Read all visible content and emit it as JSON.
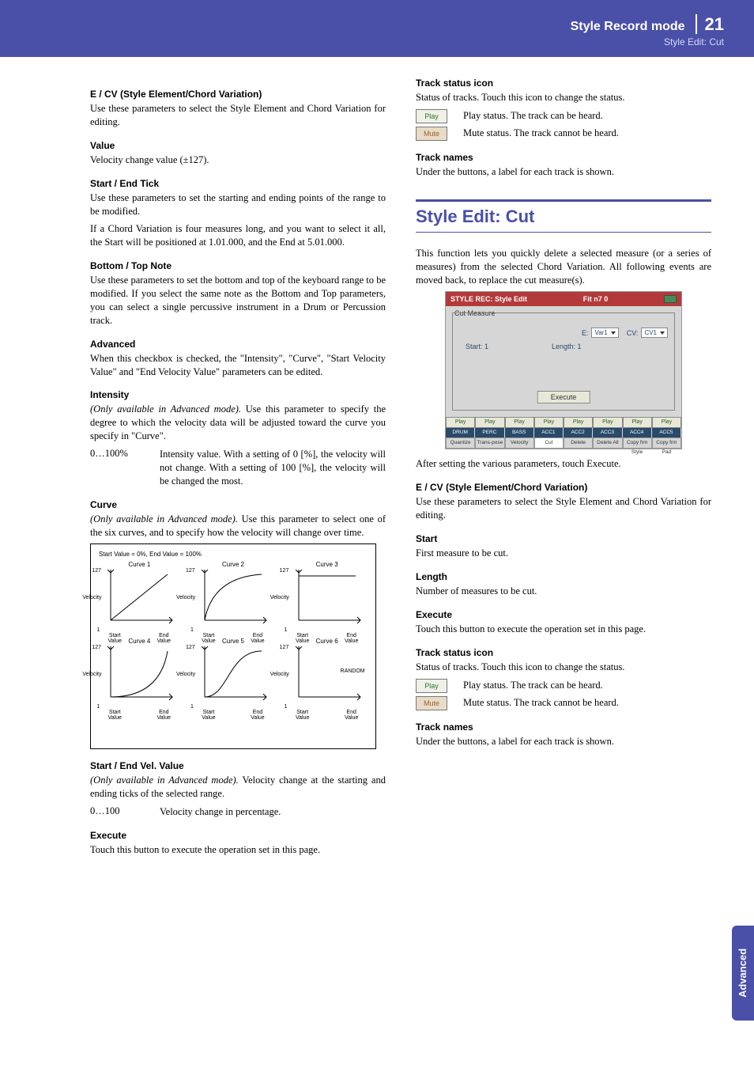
{
  "header": {
    "title": "Style Record mode",
    "page_number": "21",
    "subtitle": "Style Edit: Cut"
  },
  "side_tab": "Advanced",
  "left": {
    "h_ecv": "E / CV (Style Element/Chord Variation)",
    "p_ecv": "Use these parameters to select the Style Element and Chord Variation for editing.",
    "h_value": "Value",
    "p_value": "Velocity change value (±127).",
    "h_set": "Start / End Tick",
    "p_set1": "Use these parameters to set the starting and ending points of the range to be modified.",
    "p_set2": "If a Chord Variation is four measures long, and you want to select it all, the Start will be positioned at 1.01.000, and the End at 5.01.000.",
    "h_btn": "Bottom / Top Note",
    "p_btn": "Use these parameters to set the bottom and top of the keyboard range to be modified. If you select the same note as the Bottom and Top parameters, you can select a single percussive instrument in a Drum or Percussion track.",
    "h_adv": "Advanced",
    "p_adv": "When this checkbox is checked, the \"Intensity\", \"Curve\", \"Start Velocity Value\" and \"End Velocity Value\" parameters can be edited.",
    "h_int": "Intensity",
    "p_int_lead": "(Only available in Advanced mode).",
    "p_int_rest": " Use this parameter to specify the degree to which the velocity data will be adjusted toward the curve you specify in \"Curve\".",
    "int_range": "0…100%",
    "int_desc": "Intensity value. With a setting of 0 [%], the velocity will not change. With a setting of 100 [%], the velocity will be changed the most.",
    "h_curve": "Curve",
    "p_curve_lead": "(Only available in Advanced mode).",
    "p_curve_rest": " Use this parameter to select one of the six curves, and to specify how the velocity will change over time.",
    "h_sev": "Start / End Vel. Value",
    "p_sev_lead": "(Only available in Advanced mode).",
    "p_sev_rest": " Velocity change at the starting and ending ticks of the selected range.",
    "sev_range": "0…100",
    "sev_desc": "Velocity change in percentage.",
    "h_exec": "Execute",
    "p_exec": "Touch this button to execute the operation set in this page."
  },
  "chart_data": {
    "type": "line",
    "caption": "Start Value = 0%, End Value = 100%",
    "y_label": "Velocity",
    "y_max": 127,
    "y_min": 1,
    "x_start": "Start Value",
    "x_end": "End Value",
    "curves": [
      {
        "name": "Curve 1",
        "shape": "linear"
      },
      {
        "name": "Curve 2",
        "shape": "ease-out"
      },
      {
        "name": "Curve 3",
        "shape": "step-end"
      },
      {
        "name": "Curve 4",
        "shape": "ease-in"
      },
      {
        "name": "Curve 5",
        "shape": "s-curve"
      },
      {
        "name": "Curve 6",
        "shape": "random",
        "label": "RANDOM"
      }
    ]
  },
  "right": {
    "h_tsi": "Track status icon",
    "p_tsi": "Status of tracks. Touch this icon to change the status.",
    "play_btn": "Play",
    "play_desc": "Play status. The track can be heard.",
    "mute_btn": "Mute",
    "mute_desc": "Mute status. The track cannot be heard.",
    "h_tn": "Track names",
    "p_tn": "Under the buttons, a label for each track is shown.",
    "section_title": "Style Edit: Cut",
    "p_intro": "This function lets you quickly delete a selected measure (or a series of measures) from the selected Chord Variation. All following events are moved back, to replace the cut measure(s).",
    "p_after": "After setting the various parameters, touch Execute.",
    "h_ecv": "E / CV (Style Element/Chord Variation)",
    "p_ecv": "Use these parameters to select the Style Element and Chord Variation for editing.",
    "h_start": "Start",
    "p_start": "First measure to be cut.",
    "h_len": "Length",
    "p_len": "Number of measures to be cut.",
    "h_exec": "Execute",
    "p_exec": "Touch this button to execute the operation set in this page."
  },
  "screenshot": {
    "title_left": "STYLE REC: Style Edit",
    "title_right": "Fit n7 0",
    "legend": "Cut Measure",
    "e_label": "E:",
    "e_value": "Var1",
    "cv_label": "CV:",
    "cv_value": "CV1",
    "start_label": "Start: 1",
    "length_label": "Length: 1",
    "execute": "Execute",
    "play_buttons": [
      "Play",
      "Play",
      "Play",
      "Play",
      "Play",
      "Play",
      "Play",
      "Play"
    ],
    "track_labels": [
      "DRUM",
      "PERC",
      "BASS",
      "ACC1",
      "ACC2",
      "ACC3",
      "ACC4",
      "ACC5"
    ],
    "tabs": [
      "Quantize",
      "Trans-pose",
      "Velocity",
      "Cut",
      "Delete",
      "Delete All",
      "Copy frm Style",
      "Copy frm Pad"
    ]
  }
}
